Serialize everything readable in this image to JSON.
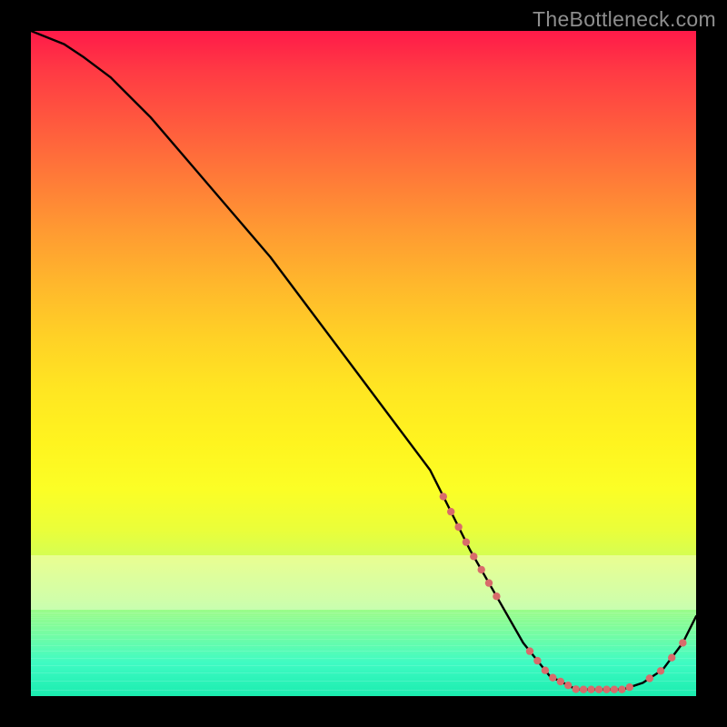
{
  "watermark": "TheBottleneck.com",
  "colors": {
    "curve": "#000000",
    "marker": "#d86b6b",
    "background": "#000000"
  },
  "chart_data": {
    "type": "line",
    "title": "",
    "xlabel": "",
    "ylabel": "",
    "xlim": [
      0,
      100
    ],
    "ylim": [
      0,
      100
    ],
    "grid": false,
    "legend": false,
    "x": [
      0,
      5,
      8,
      12,
      18,
      24,
      30,
      36,
      42,
      48,
      54,
      60,
      63,
      66,
      70,
      74,
      78,
      82,
      86,
      89,
      92,
      95,
      98,
      100
    ],
    "values": [
      100,
      98,
      96,
      93,
      87,
      80,
      73,
      66,
      58,
      50,
      42,
      34,
      28,
      22,
      15,
      8,
      3,
      1,
      1,
      1,
      2,
      4,
      8,
      12
    ],
    "note": "Single-series descending bottleneck curve; values are percent-scale estimates read from a v-shaped black line with a minimum near x≈82 and a slight rise toward x=100.",
    "markers": {
      "clusters": [
        {
          "approx_x_range": [
            62,
            70
          ],
          "approx_y_range": [
            12,
            25
          ],
          "count": 8,
          "description": "short pink segment/points along falling edge near the knee"
        },
        {
          "approx_x_range": [
            75,
            90
          ],
          "approx_y_range": [
            0,
            2
          ],
          "count": 14,
          "description": "dense row of pink dots sitting on the flat minimum"
        },
        {
          "approx_x_range": [
            93,
            98
          ],
          "approx_y_range": [
            4,
            10
          ],
          "count": 4,
          "description": "pink dots on the short rising tail at the right edge"
        }
      ],
      "color": "#d86b6b"
    }
  }
}
